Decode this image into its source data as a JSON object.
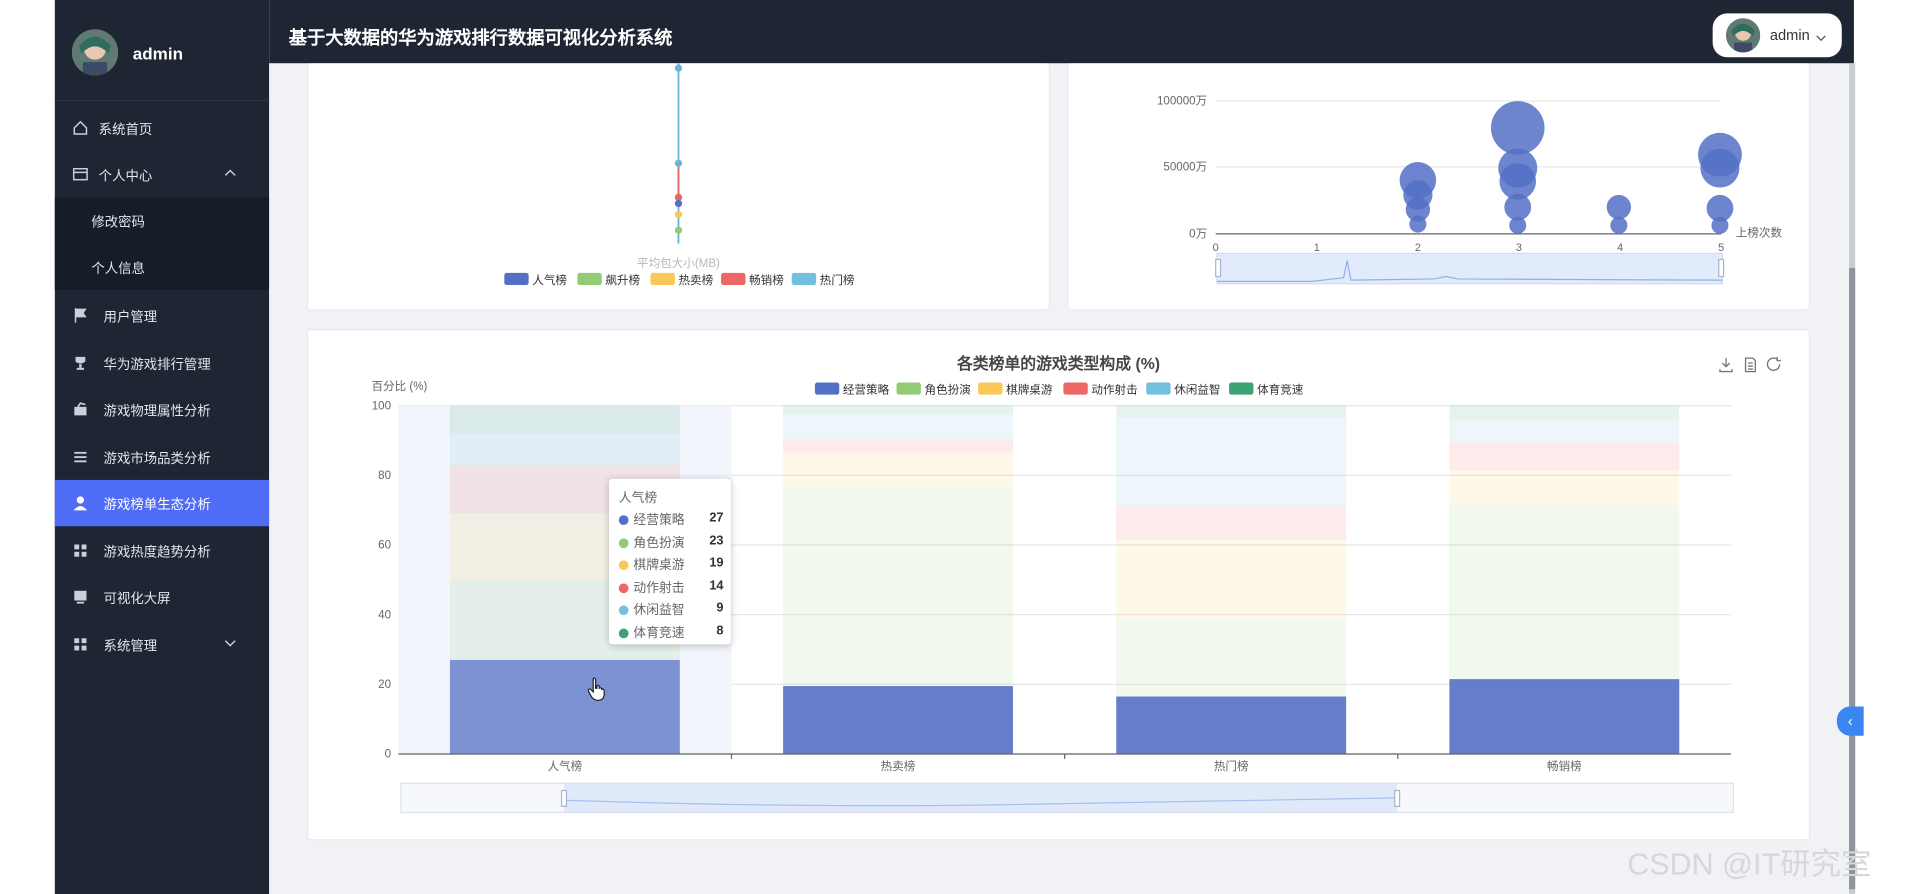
{
  "app": {
    "title": "基于大数据的华为游戏排行数据可视化分析系统",
    "user": "admin"
  },
  "sidebar": {
    "username": "admin",
    "items": [
      {
        "label": "系统首页",
        "icon": "home-icon"
      },
      {
        "label": "个人中心",
        "icon": "profile-card-icon",
        "expanded": true
      },
      {
        "label": "修改密码",
        "sub": true
      },
      {
        "label": "个人信息",
        "sub": true
      },
      {
        "label": "用户管理",
        "icon": "flag-icon"
      },
      {
        "label": "华为游戏排行管理",
        "icon": "trophy-icon"
      },
      {
        "label": "游戏物理属性分析",
        "icon": "box-icon"
      },
      {
        "label": "游戏市场品类分析",
        "icon": "list-icon"
      },
      {
        "label": "游戏榜单生态分析",
        "icon": "user-icon",
        "active": true
      },
      {
        "label": "游戏热度趋势分析",
        "icon": "grid-icon"
      },
      {
        "label": "可视化大屏",
        "icon": "monitor-icon"
      },
      {
        "label": "系统管理",
        "icon": "grid-icon",
        "collapsed": true
      }
    ]
  },
  "top_left_chart": {
    "axis_label": "平均包大小(MB)",
    "legend": [
      "人气榜",
      "飙升榜",
      "热卖榜",
      "畅销榜",
      "热门榜"
    ]
  },
  "top_right_chart": {
    "y_ticks": [
      "0万",
      "50000万",
      "100000万"
    ],
    "x_ticks": [
      "0",
      "1",
      "2",
      "3",
      "4",
      "5"
    ],
    "x_label": "上榜次数"
  },
  "chart_data": {
    "type": "bar",
    "stacked": true,
    "title": "各类榜单的游戏类型构成 (%)",
    "ylabel": "百分比 (%)",
    "ylim": [
      0,
      100
    ],
    "y_ticks": [
      "0",
      "20",
      "40",
      "60",
      "80",
      "100"
    ],
    "categories": [
      "人气榜",
      "热卖榜",
      "热门榜",
      "畅销榜"
    ],
    "series": [
      {
        "name": "经营策略",
        "color": "#5470c6",
        "values": [
          27,
          19.5,
          16.5,
          21.5
        ]
      },
      {
        "name": "角色扮演",
        "color": "#91cc75",
        "values": [
          23,
          57,
          22,
          50
        ]
      },
      {
        "name": "棋牌桌游",
        "color": "#fac858",
        "values": [
          19,
          10,
          23,
          10
        ]
      },
      {
        "name": "动作射击",
        "color": "#ee6666",
        "values": [
          14,
          4,
          10,
          8
        ]
      },
      {
        "name": "休闲益智",
        "color": "#73c0de",
        "values": [
          9,
          7,
          25,
          6.5
        ]
      },
      {
        "name": "体育竞速",
        "color": "#3ba272",
        "values": [
          8,
          2.5,
          3.5,
          4
        ]
      }
    ],
    "hover_index": 0,
    "grid": true,
    "legend_position": "top"
  },
  "tooltip": {
    "title": "人气榜",
    "rows": [
      {
        "label": "经营策略",
        "value": "27",
        "color": "#5470c6"
      },
      {
        "label": "角色扮演",
        "value": "23",
        "color": "#91cc75"
      },
      {
        "label": "棋牌桌游",
        "value": "19",
        "color": "#fac858"
      },
      {
        "label": "动作射击",
        "value": "14",
        "color": "#ee6666"
      },
      {
        "label": "休闲益智",
        "value": "9",
        "color": "#73c0de"
      },
      {
        "label": "体育竞速",
        "value": "8",
        "color": "#3ba272"
      }
    ]
  },
  "watermark": "CSDN @IT研究室"
}
